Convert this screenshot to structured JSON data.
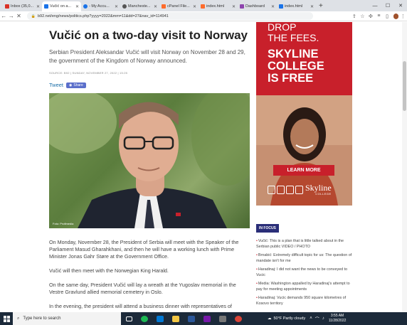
{
  "browser": {
    "tabs": [
      {
        "label": "Inbox (35,0...",
        "color": "#d93025",
        "active": false
      },
      {
        "label": "Vučić on a...",
        "color": "#1a73e8",
        "active": true
      },
      {
        "label": "- My Accu...",
        "color": "#1a73e8",
        "active": false
      },
      {
        "label": "Mancheste...",
        "color": "#555555",
        "active": false
      },
      {
        "label": "cPanel File...",
        "color": "#ff6c2c",
        "active": false
      },
      {
        "label": "index.html",
        "color": "#ff6c2c",
        "active": false
      },
      {
        "label": "Dashboard",
        "color": "#8e44ad",
        "active": false
      },
      {
        "label": "index.html",
        "color": "#1a73e8",
        "active": false
      }
    ],
    "url": "b92.net/eng/news/politics.php?yyyy=2022&mm=11&dd=27&nav_id=114941"
  },
  "article": {
    "headline": "Vučić on a two-day visit to Norway",
    "lede": "Serbian President Aleksandar Vučić will visit Norway on November 28 and 29, the government of the Kingdom of Norway announced.",
    "source": "SOURCE: B92 | SUNDAY, NOVEMBER 27, 2022 | 15:25",
    "tweet": "Tweet",
    "share": "Share",
    "photo_credit": "Foto: Profimedia",
    "paragraphs": [
      "On Monday, November 28, the President of Serbia will meet with the Speaker of the Parliament Masud Gharahkhani, and then he will have a working lunch with Prime Minister Jonas Gahr Støre at the Government Office.",
      "Vučić will then meet with the Norwegian King Harald.",
      "On the same day, President Vučić will lay a wreath at the Yugoslav memorial in the Vestre Gravlund allied memorial cemetery in Oslo.",
      "In the evening, the president will attend a business dinner with representatives of"
    ]
  },
  "ad": {
    "line1": "DROP",
    "line2": "THE FEES.",
    "line3": "SKYLINE",
    "line4": "COLLEGE",
    "line5": "IS FREE",
    "button": "LEARN MORE",
    "logo": "Skyline",
    "logo_sub": "COLLEGE"
  },
  "in_focus": {
    "title": "IN FOCUS",
    "items": [
      "Vučić: This is a plan that is little talked about in the Serbian public VIDEO / PHOTO",
      "Brnabić: Extremely difficult topic for us: The question of mandate isn't for me",
      "Haradinaj: I did not want the news to be conveyed to Vucic",
      "Media: Washington appalled by Haradinaj's attempt to pay for meeting appointments",
      "Haradinaj: Vucic demands 950 square kilometres of Kosovo territory"
    ]
  },
  "taskbar": {
    "search_placeholder": "Type here to search",
    "weather": "50°F  Partly cloudy",
    "time": "3:55 AM",
    "date": "11/28/2022"
  }
}
